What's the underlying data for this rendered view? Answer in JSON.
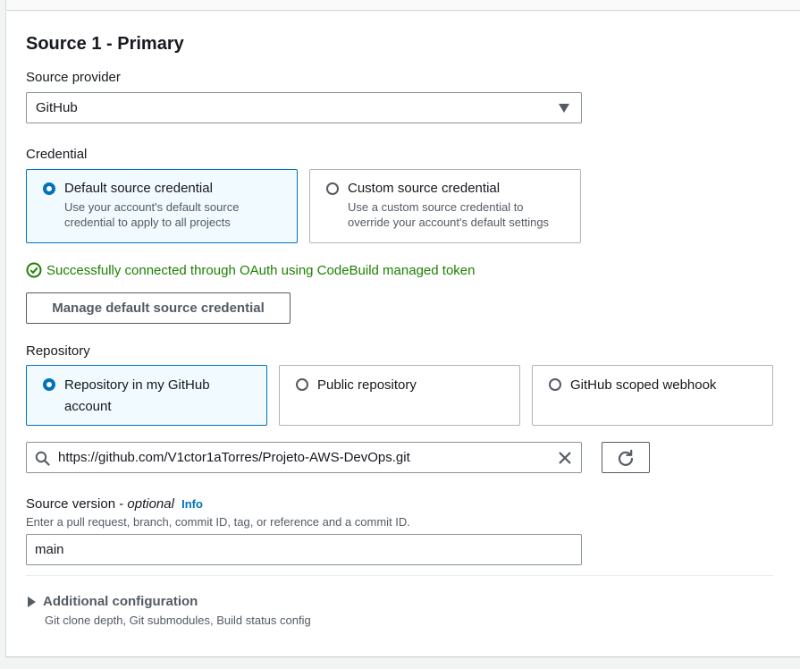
{
  "section": {
    "title": "Source 1 - Primary"
  },
  "source_provider": {
    "label": "Source provider",
    "selected": "GitHub"
  },
  "credential": {
    "label": "Credential",
    "options": [
      {
        "title": "Default source credential",
        "desc1": "Use your account's default source",
        "desc2": "credential to apply to all projects",
        "selected": true
      },
      {
        "title": "Custom source credential",
        "desc1": "Use a custom source credential to",
        "desc2": "override your account's default settings",
        "selected": false
      }
    ],
    "success_message": "Successfully connected through OAuth using CodeBuild managed token",
    "manage_button": "Manage default source credential"
  },
  "repository": {
    "label": "Repository",
    "options": [
      {
        "line1": "Repository in my GitHub",
        "line2": "account",
        "selected": true
      },
      {
        "line1": "Public repository",
        "selected": false
      },
      {
        "line1": "GitHub scoped webhook",
        "selected": false
      }
    ],
    "url_value": "https://github.com/V1ctor1aTorres/Projeto-AWS-DevOps.git"
  },
  "source_version": {
    "label": "Source version",
    "optional": "optional",
    "separator": " - ",
    "info": "Info",
    "hint": "Enter a pull request, branch, commit ID, tag, or reference and a commit ID.",
    "value": "main"
  },
  "additional": {
    "title": "Additional configuration",
    "desc": "Git clone depth, Git submodules, Build status config"
  },
  "colors": {
    "accent": "#0073bb",
    "success": "#1d8102",
    "selected_bg": "#f1faff"
  }
}
